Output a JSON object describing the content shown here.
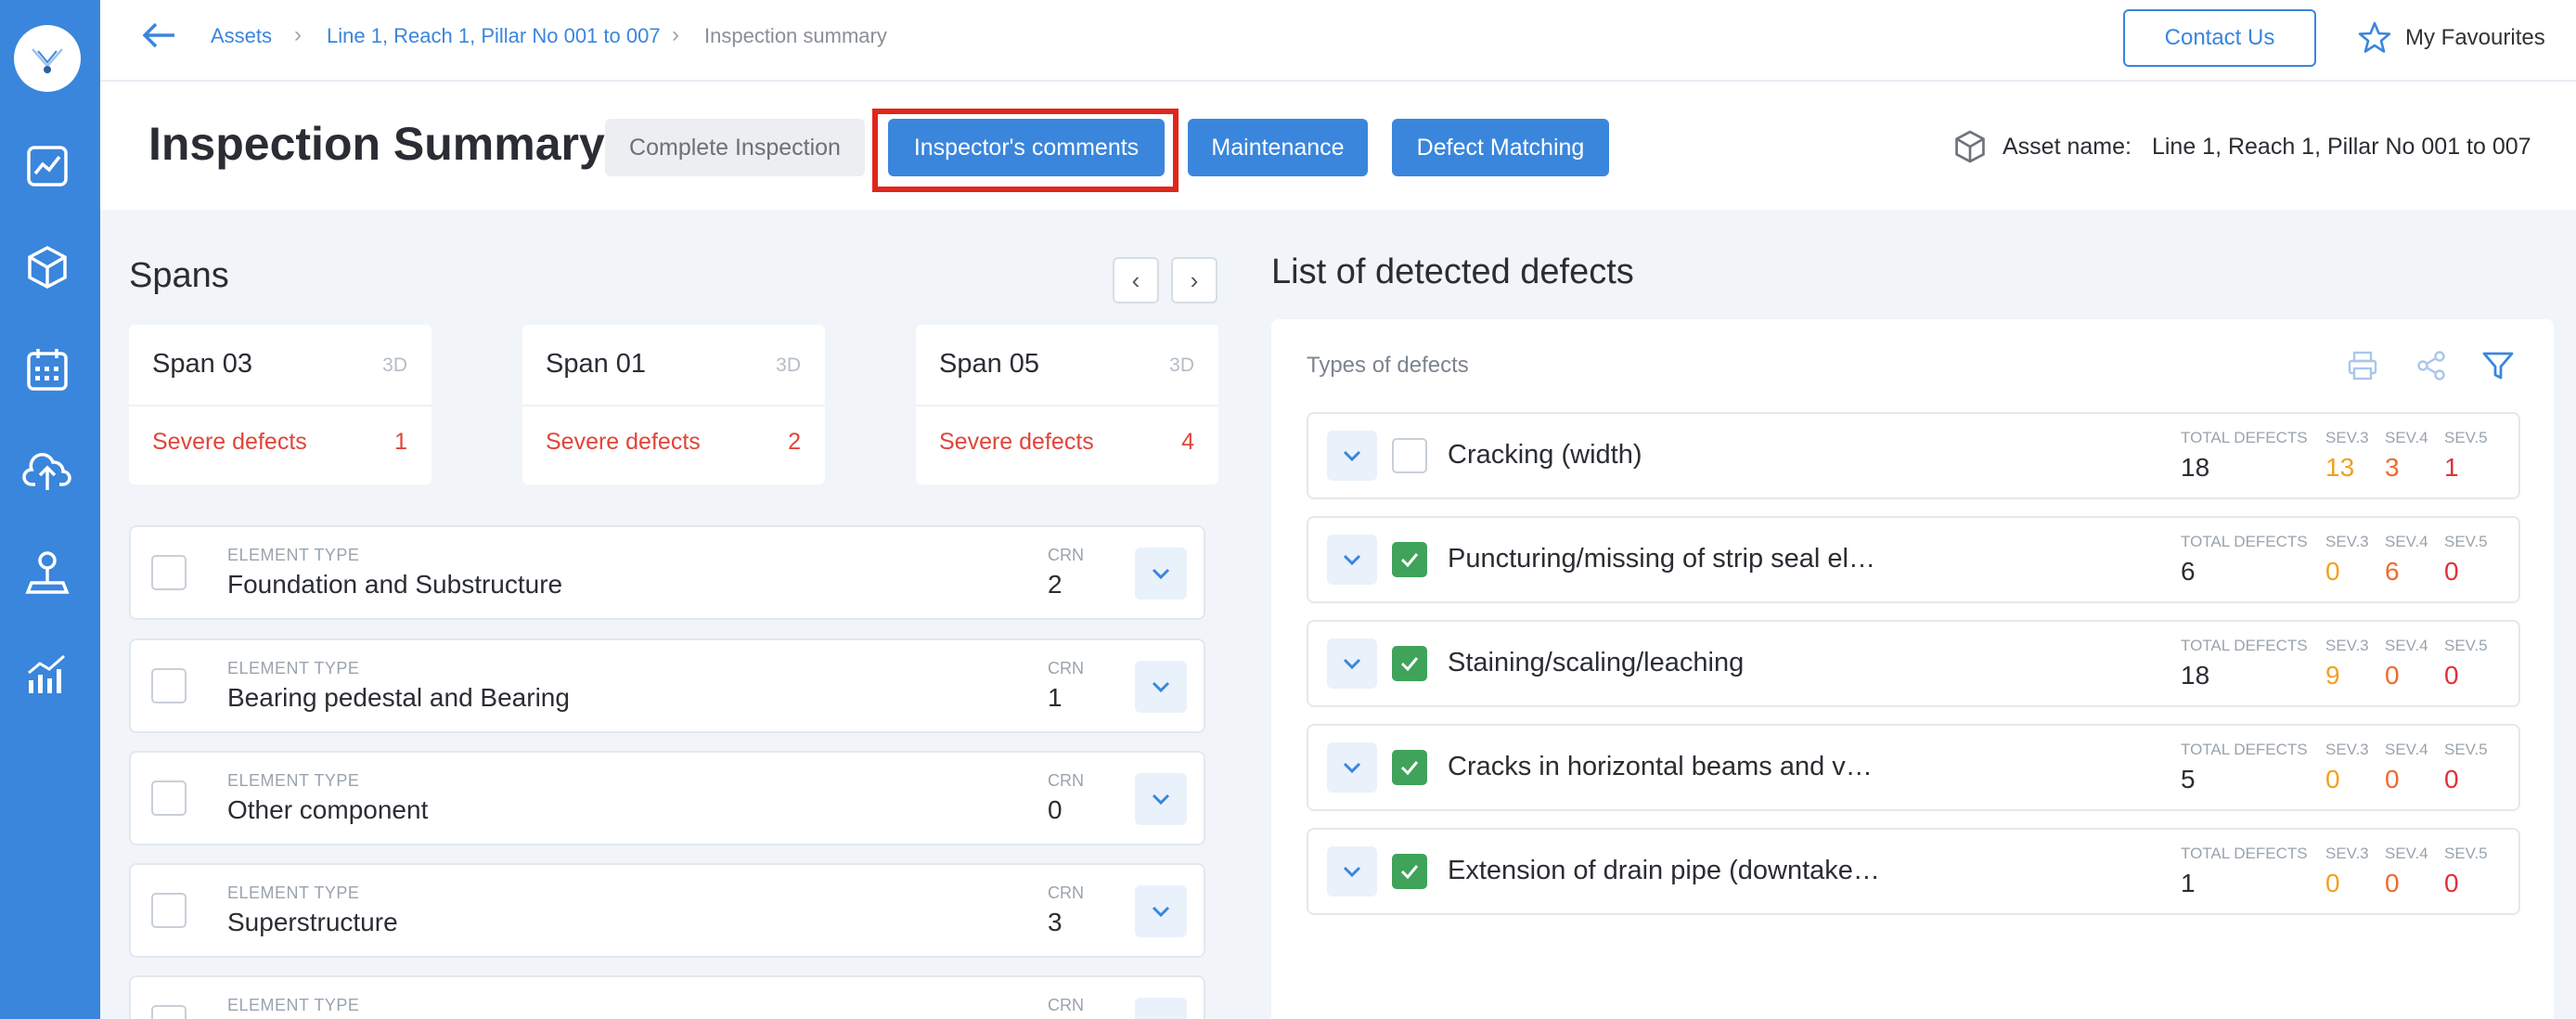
{
  "nav": {
    "breadcrumbs": [
      "Assets",
      "Line 1, Reach 1, Pillar No 001 to 007",
      "Inspection summary"
    ],
    "contact_label": "Contact Us",
    "favourites_label": "My Favourites"
  },
  "header": {
    "title": "Inspection Summary",
    "buttons": {
      "complete": "Complete Inspection",
      "comments": "Inspector's comments",
      "maintenance": "Maintenance",
      "defect_matching": "Defect Matching"
    },
    "asset_label": "Asset name:",
    "asset_name": "Line 1, Reach 1, Pillar No 001 to 007"
  },
  "spans": {
    "title": "Spans",
    "prev": "‹",
    "next": "›",
    "cards": [
      {
        "name": "Span 03",
        "tag": "3D",
        "severe_label": "Severe defects",
        "severe_count": "1"
      },
      {
        "name": "Span 01",
        "tag": "3D",
        "severe_label": "Severe defects",
        "severe_count": "2"
      },
      {
        "name": "Span 05",
        "tag": "3D",
        "severe_label": "Severe defects",
        "severe_count": "4"
      }
    ]
  },
  "elements": {
    "type_label": "ELEMENT TYPE",
    "crn_label": "CRN",
    "rows": [
      {
        "name": "Foundation and Substructure",
        "crn": "2"
      },
      {
        "name": "Bearing pedestal and Bearing",
        "crn": "1"
      },
      {
        "name": "Other component",
        "crn": "0"
      },
      {
        "name": "Superstructure",
        "crn": "3"
      },
      {
        "name": "",
        "crn": ""
      }
    ]
  },
  "defects": {
    "title": "List of detected defects",
    "types_label": "Types of defects",
    "labels": {
      "total": "TOTAL DEFECTS",
      "sev3": "SEV.3",
      "sev4": "SEV.4",
      "sev5": "SEV.5"
    },
    "rows": [
      {
        "name": "Cracking (width)",
        "checked": false,
        "total": "18",
        "sev3": "13",
        "sev4": "3",
        "sev5": "1"
      },
      {
        "name": "Puncturing/missing of strip seal ela…",
        "checked": true,
        "total": "6",
        "sev3": "0",
        "sev4": "6",
        "sev5": "0"
      },
      {
        "name": "Staining/scaling/leaching",
        "checked": true,
        "total": "18",
        "sev3": "9",
        "sev4": "0",
        "sev5": "0"
      },
      {
        "name": "Cracks in horizontal beams and ver…",
        "checked": true,
        "total": "5",
        "sev3": "0",
        "sev4": "0",
        "sev5": "0"
      },
      {
        "name": "Extension of drain pipe (downtake …",
        "checked": true,
        "total": "1",
        "sev3": "0",
        "sev4": "0",
        "sev5": "0"
      }
    ]
  },
  "colors": {
    "accent": "#3a86dc",
    "severe": "#e0453a",
    "sev3": "#f0a020",
    "sev4": "#ee6a2e",
    "sev5": "#e0303a",
    "checked": "#3fa35a",
    "highlight": "#e0261b"
  },
  "icons": {
    "sidebar": [
      "dashboard-chart-icon",
      "asset-cube-icon",
      "calendar-icon",
      "cloud-upload-icon",
      "inspector-map-pin-icon",
      "analytics-bars-icon"
    ],
    "tools": [
      "print-icon",
      "share-icon",
      "filter-icon"
    ]
  }
}
